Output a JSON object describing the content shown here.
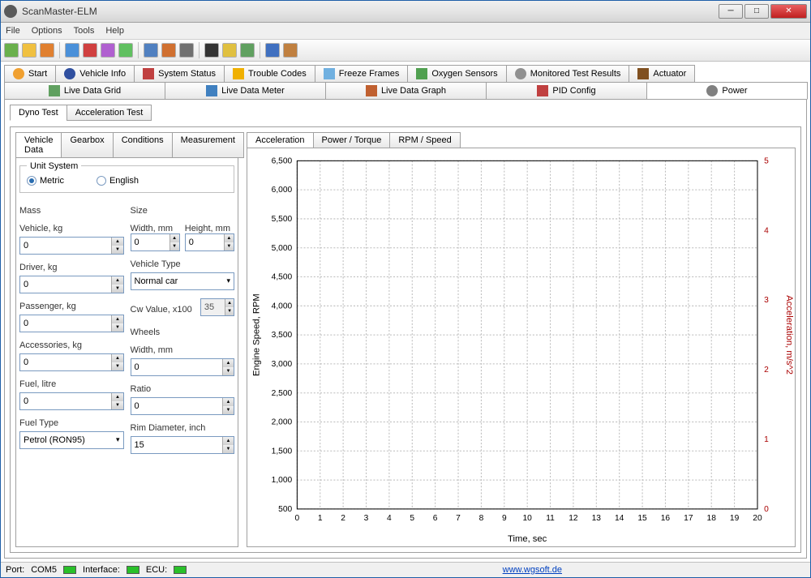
{
  "window": {
    "title": "ScanMaster-ELM"
  },
  "menu": {
    "file": "File",
    "options": "Options",
    "tools": "Tools",
    "help": "Help"
  },
  "topTabs": [
    {
      "label": "Start"
    },
    {
      "label": "Vehicle Info"
    },
    {
      "label": "System Status"
    },
    {
      "label": "Trouble Codes"
    },
    {
      "label": "Freeze Frames"
    },
    {
      "label": "Oxygen Sensors"
    },
    {
      "label": "Monitored Test Results"
    },
    {
      "label": "Actuator"
    }
  ],
  "secondTabs": [
    {
      "label": "Live Data Grid"
    },
    {
      "label": "Live Data Meter"
    },
    {
      "label": "Live Data Graph"
    },
    {
      "label": "PID Config"
    },
    {
      "label": "Power"
    }
  ],
  "testTabs": {
    "dyno": "Dyno Test",
    "accel": "Acceleration Test"
  },
  "vdTabs": {
    "vd": "Vehicle Data",
    "gb": "Gearbox",
    "cond": "Conditions",
    "meas": "Measurement"
  },
  "chartTabs": {
    "acc": "Acceleration",
    "pt": "Power / Torque",
    "rs": "RPM / Speed"
  },
  "unitSystem": {
    "legend": "Unit System",
    "metric": "Metric",
    "english": "English"
  },
  "mass": {
    "legend": "Mass",
    "vehicle_lbl": "Vehicle, kg",
    "vehicle": "0",
    "driver_lbl": "Driver, kg",
    "driver": "0",
    "passenger_lbl": "Passenger, kg",
    "passenger": "0",
    "accessories_lbl": "Accessories, kg",
    "accessories": "0",
    "fuel_lbl": "Fuel, litre",
    "fuel": "0",
    "fueltype_lbl": "Fuel Type",
    "fueltype": "Petrol (RON95)"
  },
  "size": {
    "legend": "Size",
    "width_lbl": "Width, mm",
    "width": "0",
    "height_lbl": "Height, mm",
    "height": "0",
    "vtype_lbl": "Vehicle Type",
    "vtype": "Normal car",
    "cw_lbl": "Cw Value, x100",
    "cw": "35"
  },
  "wheels": {
    "legend": "Wheels",
    "width_lbl": "Width, mm",
    "width": "0",
    "ratio_lbl": "Ratio",
    "ratio": "0",
    "rim_lbl": "Rim Diameter, inch",
    "rim": "15"
  },
  "chart_data": {
    "type": "line",
    "title": "",
    "xlabel": "Time, sec",
    "ylabel": "Engine Speed, RPM",
    "y2label": "Acceleration, m/s^2",
    "x_ticks": [
      0,
      1,
      2,
      3,
      4,
      5,
      6,
      7,
      8,
      9,
      10,
      11,
      12,
      13,
      14,
      15,
      16,
      17,
      18,
      19,
      20
    ],
    "y_ticks": [
      500,
      1000,
      1500,
      2000,
      2500,
      3000,
      3500,
      4000,
      4500,
      5000,
      5500,
      6000,
      6500
    ],
    "y2_ticks": [
      0,
      1,
      2,
      3,
      4,
      5
    ],
    "xlim": [
      0,
      20
    ],
    "ylim": [
      500,
      6500
    ],
    "y2lim": [
      0,
      5
    ],
    "series": []
  },
  "status": {
    "port_lbl": "Port:",
    "port": "COM5",
    "iface_lbl": "Interface:",
    "ecu_lbl": "ECU:",
    "url": "www.wgsoft.de"
  }
}
